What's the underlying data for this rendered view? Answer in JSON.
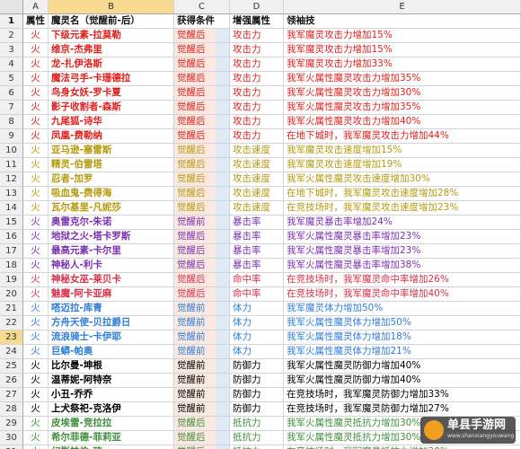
{
  "colors": {
    "red": "#e0201c",
    "orange": "#f07d1a",
    "gold": "#b59a0c",
    "green": "#3f8f3c",
    "purple": "#7b2fb3",
    "pinkred": "#d9304a",
    "blue": "#2f7ed8",
    "black": "#000000"
  },
  "column_headers": [
    "A",
    "B",
    "C",
    "D",
    "E"
  ],
  "header_row": {
    "row_num": "1",
    "attr": "属性",
    "name": "魔灵名（觉醒前-后）",
    "condition": "获得条件",
    "boost": "增强属性",
    "skill": "领袖技"
  },
  "rows": [
    {
      "n": "2",
      "attr": "火",
      "name": "下级元素-拉莫勒",
      "cond": "觉醒后",
      "boost": "攻击力",
      "skill": "我军魔灵攻击力增加15%",
      "color": "red"
    },
    {
      "n": "3",
      "attr": "火",
      "name": "维京-杰弗里",
      "cond": "觉醒后",
      "boost": "攻击力",
      "skill": "我军魔灵攻击力增加15%",
      "color": "red"
    },
    {
      "n": "4",
      "attr": "火",
      "name": "龙-扎伊洛斯",
      "cond": "觉醒后",
      "boost": "攻击力",
      "skill": "我军魔灵攻击力增加33%",
      "color": "red"
    },
    {
      "n": "5",
      "attr": "火",
      "name": "魔法弓手-卡珊德拉",
      "cond": "觉醒后",
      "boost": "攻击力",
      "skill": "我军火属性魔灵攻击力增加35%",
      "color": "red"
    },
    {
      "n": "6",
      "attr": "火",
      "name": "鸟身女妖-罗卡夏",
      "cond": "觉醒后",
      "boost": "攻击力",
      "skill": "我军火属性魔灵攻击力增加30%",
      "color": "red"
    },
    {
      "n": "7",
      "attr": "火",
      "name": "影子收割者-森斯",
      "cond": "觉醒后",
      "boost": "攻击力",
      "skill": "我军火属性魔灵攻击力增加35%",
      "color": "red"
    },
    {
      "n": "8",
      "attr": "火",
      "name": "九尾狐-诗华",
      "cond": "觉醒后",
      "boost": "攻击力",
      "skill": "我军火属性魔灵攻击力增加40%",
      "color": "red"
    },
    {
      "n": "9",
      "attr": "火",
      "name": "凤凰-费勒纳",
      "cond": "觉醒后",
      "boost": "攻击力",
      "skill": "在地下城时，我军魔灵攻击力增加44%",
      "color": "red"
    },
    {
      "n": "10",
      "attr": "火",
      "name": "亚马逊-塞雷斯",
      "cond": "觉醒后",
      "boost": "攻击速度",
      "skill": "我军魔灵攻击速度增加15%",
      "color": "gold"
    },
    {
      "n": "11",
      "attr": "火",
      "name": "精灵-伯雷塔",
      "cond": "觉醒后",
      "boost": "攻击速度",
      "skill": "我军魔灵攻击速度增加19%",
      "color": "gold"
    },
    {
      "n": "12",
      "attr": "火",
      "name": "忍者-加罗",
      "cond": "觉醒后",
      "boost": "攻击速度",
      "skill": "我军火属性魔灵攻击速度增加30%",
      "color": "gold"
    },
    {
      "n": "13",
      "attr": "火",
      "name": "吸血鬼-费得海",
      "cond": "觉醒后",
      "boost": "攻击速度",
      "skill": "在地下城时，我军魔灵攻击速度增加28%",
      "color": "gold"
    },
    {
      "n": "14",
      "attr": "火",
      "name": "瓦尔基里-凡妮莎",
      "cond": "觉醒后",
      "boost": "攻击速度",
      "skill": "在竞技场时，我军魔灵攻击速度增加23%",
      "color": "gold"
    },
    {
      "n": "15",
      "attr": "火",
      "name": "奥雷克尔-朱诺",
      "cond": "觉醒前",
      "boost": "暴击率",
      "skill": "我军魔灵暴击率增加24%",
      "color": "purple"
    },
    {
      "n": "16",
      "attr": "火",
      "name": "地狱之火-塔卡罗斯",
      "cond": "觉醒后",
      "boost": "暴击率",
      "skill": "我军火属性魔灵暴击率增加23%",
      "color": "purple"
    },
    {
      "n": "17",
      "attr": "火",
      "name": "最高元素-卡尔里",
      "cond": "觉醒后",
      "boost": "暴击率",
      "skill": "我军火属性魔灵暴击率增加23%",
      "color": "purple"
    },
    {
      "n": "18",
      "attr": "火",
      "name": "神秘人-利卡",
      "cond": "觉醒后",
      "boost": "暴击率",
      "skill": "我军火属性魔灵暴击率增加38%",
      "color": "purple"
    },
    {
      "n": "19",
      "attr": "火",
      "name": "神秘女巫-莱贝卡",
      "cond": "觉醒后",
      "boost": "命中率",
      "skill": "在竞技场时，我军魔灵命中率增加26%",
      "color": "pinkred"
    },
    {
      "n": "20",
      "attr": "火",
      "name": "魅魔-阿卡亚麻",
      "cond": "觉醒后",
      "boost": "命中率",
      "skill": "在竞技场时，我军魔灵命中率增加40%",
      "color": "pinkred"
    },
    {
      "n": "21",
      "attr": "火",
      "name": "嗒迈拉-库青",
      "cond": "觉醒前",
      "boost": "体力",
      "skill": "我军魔灵体力增加50%",
      "color": "blue"
    },
    {
      "n": "22",
      "attr": "火",
      "name": "方舟天使-贝拉爵日",
      "cond": "觉醒前",
      "boost": "体力",
      "skill": "我军火属性魔灵体力增加50%",
      "color": "blue"
    },
    {
      "n": "23",
      "attr": "火",
      "name": "流浪骑士-卡伊耶",
      "cond": "觉醒前",
      "boost": "体力",
      "skill": "我军火属性魔灵体力增加18%",
      "color": "blue"
    },
    {
      "n": "24",
      "attr": "火",
      "name": "巨蟒-帕奥",
      "cond": "觉醒前",
      "boost": "体力",
      "skill": "我军火属性魔灵体力增加21%",
      "color": "blue"
    },
    {
      "n": "25",
      "attr": "火",
      "name": "比尔曼-坤根",
      "cond": "觉醒前",
      "boost": "防御力",
      "skill": "我军火属性魔灵防御力增加40%",
      "color": "black"
    },
    {
      "n": "26",
      "attr": "火",
      "name": "温蒂妮-阿特奈",
      "cond": "觉醒前",
      "boost": "防御力",
      "skill": "我军火属性魔灵防御力增加40%",
      "color": "black"
    },
    {
      "n": "27",
      "attr": "火",
      "name": "小丑-乔乔",
      "cond": "觉醒前",
      "boost": "防御力",
      "skill": "在竞技场时，我军魔灵防御力增加33%",
      "color": "black"
    },
    {
      "n": "28",
      "attr": "火",
      "name": "上犬祭祀-克洛伊",
      "cond": "觉醒前",
      "boost": "防御力",
      "skill": "在竞技场时，我军魔灵防御力增加27%",
      "color": "black"
    },
    {
      "n": "29",
      "attr": "火",
      "name": "皮埃雷-竞拉拉",
      "cond": "觉醒后",
      "boost": "抵抗力",
      "skill": "我军火属性魔灵抵抗力增加30%",
      "color": "green"
    },
    {
      "n": "30",
      "attr": "火",
      "name": "希尔菲德-菲莉亚",
      "cond": "觉醒后",
      "boost": "抵抗力",
      "skill": "我军火属性魔灵抵抗力增加30%",
      "color": "green"
    },
    {
      "n": "31",
      "attr": "火",
      "name": "幻影神偷-琼",
      "cond": "觉醒后",
      "boost": "抵抗力",
      "skill": "在竞技场时，我军魔灵抵抗力增加30%",
      "color": "green"
    }
  ],
  "selected_row": "23",
  "watermark": {
    "text": "单县手游网",
    "sub": "www.shanxiangyouwang"
  }
}
